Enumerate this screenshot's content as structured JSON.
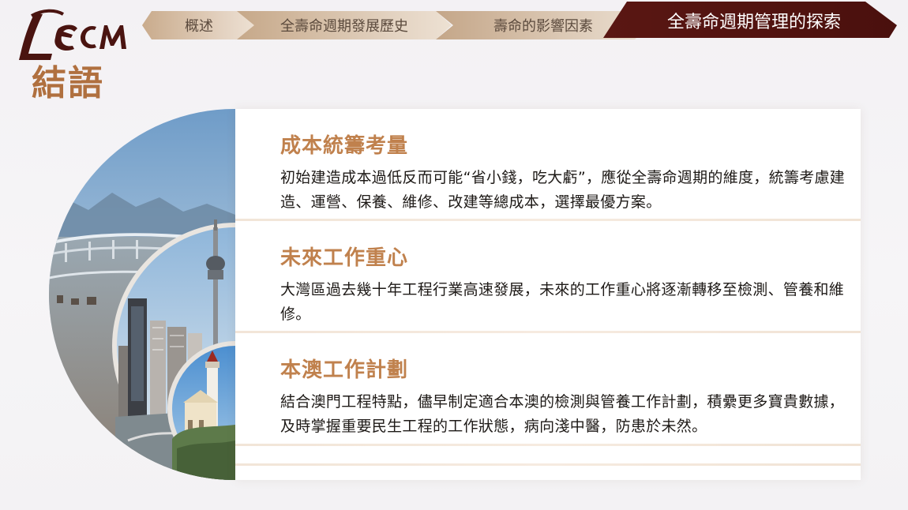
{
  "logo": {
    "text": "LECM"
  },
  "page_title": "結語",
  "tabs": [
    {
      "label": "概述",
      "active": false
    },
    {
      "label": "全壽命週期發展歷史",
      "active": false
    },
    {
      "label": "壽命的影響因素",
      "active": false
    },
    {
      "label": "全壽命週期管理的探索",
      "active": true
    }
  ],
  "sections": [
    {
      "heading": "成本統籌考量",
      "body": "初始建造成本過低反而可能“省小錢，吃大虧”，應從全壽命週期的維度，統籌考慮建造、運營、保養、維修、改建等總成本，選擇最優方案。"
    },
    {
      "heading": "未來工作重心",
      "body": "大灣區過去幾十年工程行業高速發展，未來的工作重心將逐漸轉移至檢測、管養和維修。"
    },
    {
      "heading": "本澳工作計劃",
      "body": "結合澳門工程特點，儘早制定適合本澳的檢測與管養工作計劃，積纍更多寶貴數據，及時掌握重要民生工程的工作狀態，病向淺中醫，防患於未然。"
    }
  ],
  "colors": {
    "accent_brown": "#c0814d",
    "title_brown": "#b0703f",
    "active_tab": "#5a1713",
    "logo_dark": "#4a1410"
  }
}
